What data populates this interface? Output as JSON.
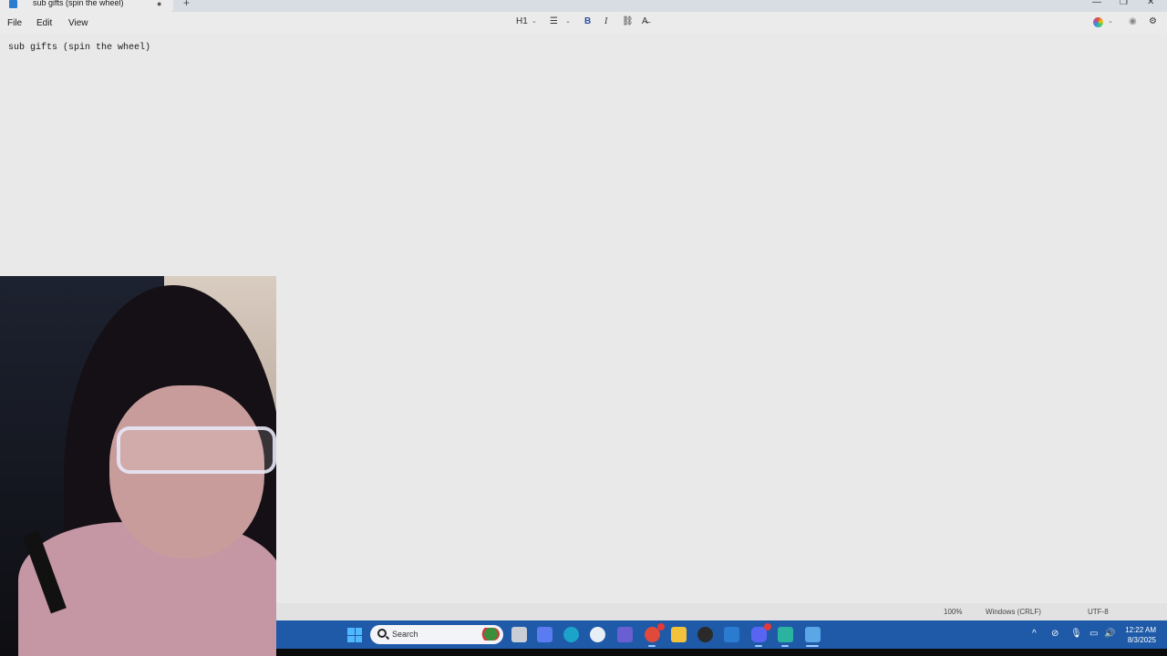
{
  "window": {
    "tab_title": "sub gifts (spin the wheel)",
    "tab_close": "●",
    "tab_add": "+",
    "controls": [
      "—",
      "❐",
      "✕"
    ]
  },
  "menu": {
    "items": [
      "File",
      "Edit",
      "View"
    ]
  },
  "toolbar": {
    "heading": "H1",
    "heading_chevron": "⌄",
    "list_icon": "☰",
    "list_chevron": "⌄",
    "bold": "B",
    "italic": "I",
    "link_icon": "⛓",
    "clear_format_icon": "A̶",
    "copilot_chevron": "⌄",
    "account_icon": "◉",
    "settings_icon": "⚙"
  },
  "document": {
    "text": "sub gifts (spin the wheel)"
  },
  "statusbar": {
    "zoom": "100%",
    "line_ending": "Windows (CRLF)",
    "encoding": "UTF-8"
  },
  "taskbar": {
    "search_placeholder": "Search",
    "tray": {
      "chevron": "^",
      "network_off": "⊘",
      "mic": "🎙",
      "display": "▭",
      "volume": "🔊"
    },
    "clock": {
      "time": "12:22 AM",
      "date": "8/3/2025"
    },
    "apps": [
      {
        "name": "file-explorer-alt",
        "color": "#c9ced6"
      },
      {
        "name": "copilot",
        "color": "#5b7cf0"
      },
      {
        "name": "edge",
        "color": "#1ba3c9"
      },
      {
        "name": "steam",
        "color": "#e8eef5"
      },
      {
        "name": "teams",
        "color": "#6a5fd1"
      },
      {
        "name": "chrome",
        "color": "#e1493b"
      },
      {
        "name": "file-explorer",
        "color": "#f2c23b"
      },
      {
        "name": "obs",
        "color": "#2a2a2a"
      },
      {
        "name": "store",
        "color": "#2b7bd1"
      },
      {
        "name": "discord",
        "color": "#5865f2"
      },
      {
        "name": "app-teal",
        "color": "#2bb3a0"
      },
      {
        "name": "notepad",
        "color": "#5aa6e6"
      }
    ]
  }
}
